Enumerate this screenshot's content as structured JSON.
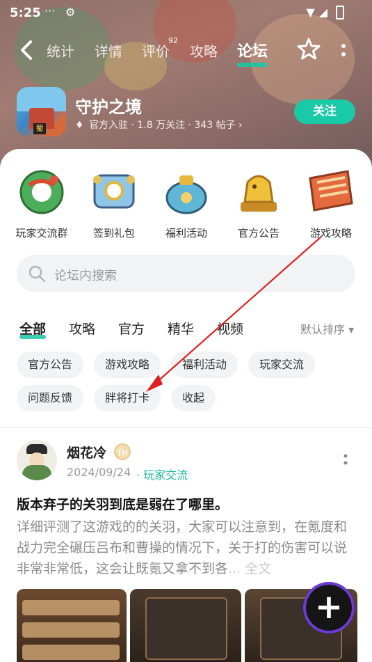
{
  "status_bar": {
    "time": "5:25",
    "dots": "···"
  },
  "nav": {
    "tabs": [
      {
        "label": "统计"
      },
      {
        "label": "详情"
      },
      {
        "label": "评价",
        "badge": "92"
      },
      {
        "label": "攻略"
      },
      {
        "label": "论坛",
        "active": true
      }
    ]
  },
  "game": {
    "title": "守护之境",
    "icon_tag": "蜀",
    "meta": "官方入驻 · 1.8 万关注 · 343 帖子 ›",
    "follow_label": "关注"
  },
  "quick_links": [
    {
      "label": "玩家交流群",
      "icon": "jade-ring-icon"
    },
    {
      "label": "签到礼包",
      "icon": "gift-scroll-icon"
    },
    {
      "label": "福利活动",
      "icon": "treasure-bag-icon"
    },
    {
      "label": "官方公告",
      "icon": "golden-beast-icon"
    },
    {
      "label": "游戏攻略",
      "icon": "guide-scroll-icon"
    }
  ],
  "search": {
    "placeholder": "论坛内搜索"
  },
  "filter_tabs": [
    {
      "label": "全部",
      "active": true
    },
    {
      "label": "攻略"
    },
    {
      "label": "官方"
    },
    {
      "label": "精华"
    },
    {
      "label": "视频"
    }
  ],
  "sort_label": "默认排序 ▾",
  "chips": [
    "官方公告",
    "游戏攻略",
    "福利活动",
    "玩家交流",
    "问题反馈",
    "胖将打卡",
    "收起"
  ],
  "post": {
    "author": "烟花冷",
    "badge": "TH",
    "date": "2024/09/24",
    "category": "· 玩家交流",
    "title": "版本弃子的关羽到底是弱在了哪里。",
    "body": "详细评测了这游戏的的关羽，大家可以注意到，在氪度和战力完全碾压吕布和曹操的情况下，关于打的伤害可以说非常非常低，这会让既氪又拿不到各",
    "expand": "... 全文"
  },
  "fab_label": "+",
  "colors": {
    "accent": "#19c6a6",
    "arrow": "#e02020"
  }
}
